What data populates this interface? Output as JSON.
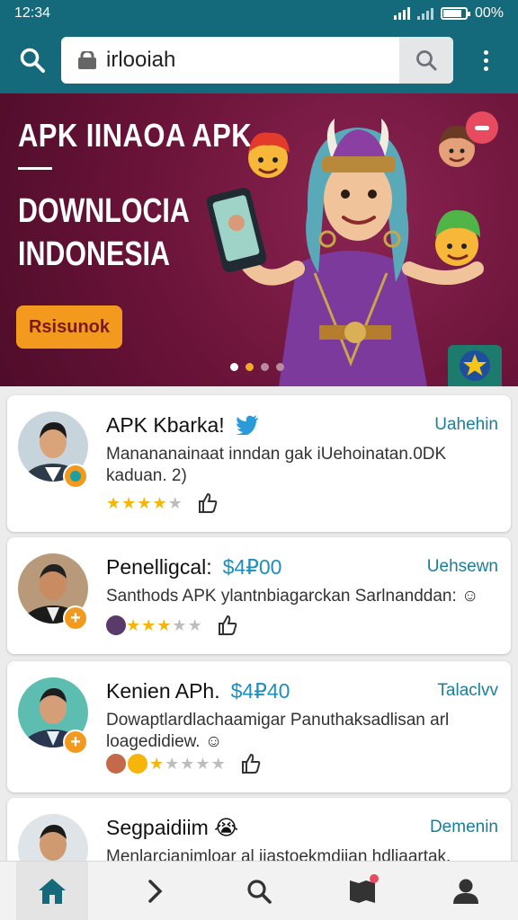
{
  "status": {
    "time": "12:34",
    "battery": "00%",
    "battery_fill": 0.85
  },
  "browser": {
    "url": "irlooiah"
  },
  "banner": {
    "title": "APK IINAOA APK",
    "dash": "—",
    "subtitle_line1": "DOWNLOCIA",
    "subtitle_line2": "INDONESIA",
    "cta_label": "Rsisunok",
    "slide_count": 4,
    "active_slide": 1
  },
  "cards": [
    {
      "title": "APK Kbarka!",
      "price": "",
      "action": "Uahehin",
      "description": "Manananainaat inndan gak iUehoinatan.0DK kaduan. 2)",
      "rating": 4,
      "badge_icon": "whatsapp-badge-icon"
    },
    {
      "title": "Penelligcal:",
      "price": "$4₽00",
      "action": "Uehsewn",
      "description": "Santhods APK ylantnbiagarckan Sarlnanddan: ☺",
      "rating": 3,
      "badge_icon": "plus-badge-icon"
    },
    {
      "title": "Kenien APh.",
      "price": "$4₽40",
      "action": "Talaclvv",
      "description": "Dowaptlardlachaamigar Panuthaksadlisan arl loagedidiew. ☺",
      "rating": 1,
      "badge_icon": "plus-badge-icon"
    },
    {
      "title": "Segpaidiim 😭",
      "price": "",
      "action": "Demenin",
      "description": "Menlarcianimloar al iiastoekmdiian hdliaartak.",
      "rating": 0,
      "badge_icon": ""
    }
  ],
  "colors": {
    "brand": "#146a7a",
    "accent": "#f39a1e",
    "banner": "#6a1338",
    "link": "#1a7e9a"
  },
  "nav": [
    "home-icon",
    "forward-icon",
    "search-icon",
    "bookmarks-icon",
    "profile-icon"
  ]
}
